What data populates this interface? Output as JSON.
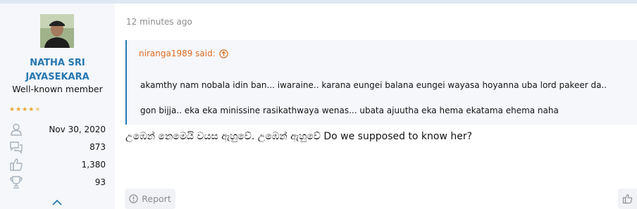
{
  "user": {
    "name": "NATHA SRI JAYASEKARA",
    "title": "Well-known member",
    "rating": 4.5,
    "stats": [
      {
        "icon": "user-icon",
        "value": "Nov 30, 2020"
      },
      {
        "icon": "messages-icon",
        "value": "873"
      },
      {
        "icon": "thumbs-up-icon",
        "value": "1,380"
      },
      {
        "icon": "trophy-icon",
        "value": "93"
      }
    ]
  },
  "post": {
    "time": "12 minutes ago",
    "quote": {
      "author": "niranga1989 said:",
      "lines": [
        "akamthy nam nobala idin ban... iwaraine.. karana eungei balana eungei wayasa hoyanna uba lord pakeer da..",
        "gon bijja.. eka eka minissine rasikathwaya wenas... ubata ajuutha eka hema ekatama ehema naha"
      ]
    },
    "message": "උඹෙන් නෙමෙයි වයස ඇහුවේ. උඹෙන් ඇහුවේ Do we supposed to know her?"
  },
  "actions": {
    "report_label": "Report"
  },
  "colors": {
    "accent": "#2577b1",
    "quote_author": "#df6b20",
    "star": "#e8a62d"
  }
}
